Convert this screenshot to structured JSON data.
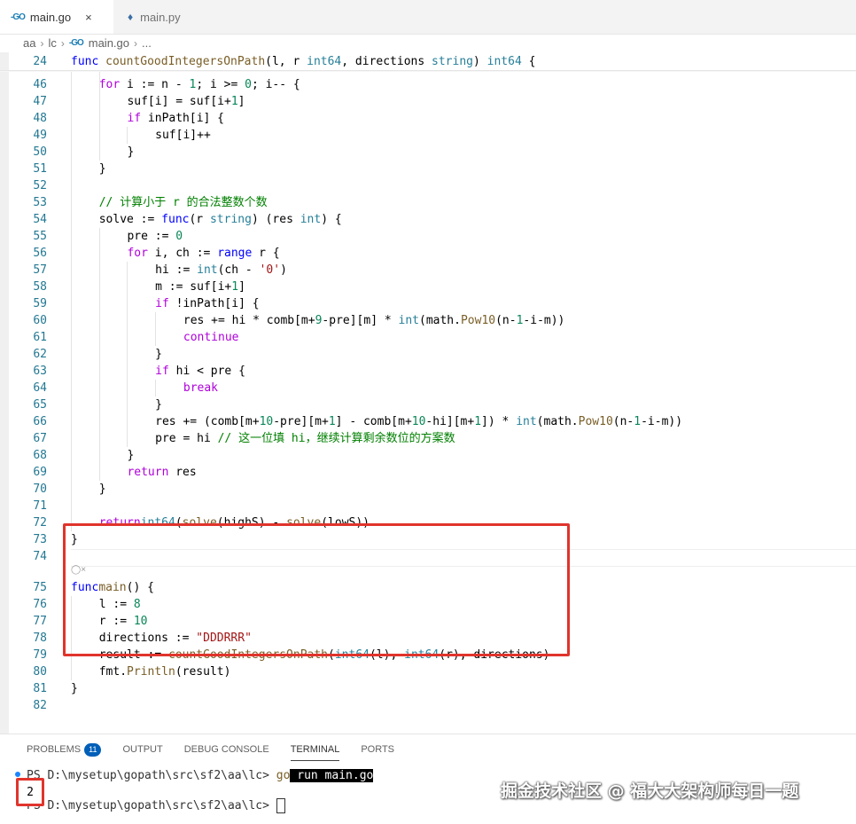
{
  "tabs": [
    {
      "label": "main.go",
      "icon": "go-file-icon",
      "active": true
    },
    {
      "label": "main.py",
      "icon": "python-file-icon",
      "active": false
    }
  ],
  "tab_icon_text": "-GO",
  "close_glyph": "×",
  "breadcrumb": [
    "aa",
    "lc",
    "main.go",
    "..."
  ],
  "sticky": {
    "ln": "24",
    "tokens": [
      [
        "kw",
        "func "
      ],
      [
        "fn",
        "countGoodIntegersOnPath"
      ],
      [
        "",
        "(l, r "
      ],
      [
        "ty",
        "int64"
      ],
      [
        "",
        ", directions "
      ],
      [
        "ty",
        "string"
      ],
      [
        "",
        ") "
      ],
      [
        "ty",
        "int64"
      ],
      [
        "",
        " {"
      ]
    ]
  },
  "code_lines": [
    {
      "ln": "46",
      "indent": 1,
      "tokens": [
        [
          "kwc",
          "for"
        ],
        [
          "",
          " i := n - "
        ],
        [
          "num",
          "1"
        ],
        [
          "",
          "; i >= "
        ],
        [
          "num",
          "0"
        ],
        [
          "",
          "; i-- {"
        ]
      ]
    },
    {
      "ln": "47",
      "indent": 2,
      "tokens": [
        [
          "",
          "suf[i] = suf[i+"
        ],
        [
          "num",
          "1"
        ],
        [
          "",
          "]"
        ]
      ]
    },
    {
      "ln": "48",
      "indent": 2,
      "tokens": [
        [
          "kwc",
          "if"
        ],
        [
          "",
          " inPath[i] {"
        ]
      ]
    },
    {
      "ln": "49",
      "indent": 3,
      "tokens": [
        [
          "",
          "suf[i]++"
        ]
      ]
    },
    {
      "ln": "50",
      "indent": 2,
      "tokens": [
        [
          "",
          "}"
        ]
      ]
    },
    {
      "ln": "51",
      "indent": 1,
      "tokens": [
        [
          "",
          "}"
        ]
      ]
    },
    {
      "ln": "52",
      "indent": 0,
      "tokens": []
    },
    {
      "ln": "53",
      "indent": 1,
      "tokens": [
        [
          "cmt",
          "// 计算小于 r 的合法整数个数"
        ]
      ]
    },
    {
      "ln": "54",
      "indent": 1,
      "tokens": [
        [
          "",
          "solve := "
        ],
        [
          "kw",
          "func"
        ],
        [
          "",
          "(r "
        ],
        [
          "ty",
          "string"
        ],
        [
          "",
          ") (res "
        ],
        [
          "ty",
          "int"
        ],
        [
          "",
          ") {"
        ]
      ]
    },
    {
      "ln": "55",
      "indent": 2,
      "tokens": [
        [
          "",
          "pre := "
        ],
        [
          "num",
          "0"
        ]
      ]
    },
    {
      "ln": "56",
      "indent": 2,
      "tokens": [
        [
          "kwc",
          "for"
        ],
        [
          "",
          " i, ch := "
        ],
        [
          "kw",
          "range"
        ],
        [
          "",
          " r {"
        ]
      ]
    },
    {
      "ln": "57",
      "indent": 3,
      "tokens": [
        [
          "",
          "hi := "
        ],
        [
          "ty",
          "int"
        ],
        [
          "",
          "(ch - "
        ],
        [
          "str",
          "'0'"
        ],
        [
          "",
          ")"
        ]
      ]
    },
    {
      "ln": "58",
      "indent": 3,
      "tokens": [
        [
          "",
          "m := suf[i+"
        ],
        [
          "num",
          "1"
        ],
        [
          "",
          "]"
        ]
      ]
    },
    {
      "ln": "59",
      "indent": 3,
      "tokens": [
        [
          "kwc",
          "if"
        ],
        [
          "",
          " !inPath[i] {"
        ]
      ]
    },
    {
      "ln": "60",
      "indent": 4,
      "tokens": [
        [
          "",
          "res += hi * comb[m+"
        ],
        [
          "num",
          "9"
        ],
        [
          "",
          "-pre][m] * "
        ],
        [
          "ty",
          "int"
        ],
        [
          "",
          "(math."
        ],
        [
          "fn",
          "Pow10"
        ],
        [
          "",
          "(n-"
        ],
        [
          "num",
          "1"
        ],
        [
          "",
          "-i-m))"
        ]
      ]
    },
    {
      "ln": "61",
      "indent": 4,
      "tokens": [
        [
          "kwc",
          "continue"
        ]
      ]
    },
    {
      "ln": "62",
      "indent": 3,
      "tokens": [
        [
          "",
          "}"
        ]
      ]
    },
    {
      "ln": "63",
      "indent": 3,
      "tokens": [
        [
          "kwc",
          "if"
        ],
        [
          "",
          " hi < pre {"
        ]
      ]
    },
    {
      "ln": "64",
      "indent": 4,
      "tokens": [
        [
          "kwc",
          "break"
        ]
      ]
    },
    {
      "ln": "65",
      "indent": 3,
      "tokens": [
        [
          "",
          "}"
        ]
      ]
    },
    {
      "ln": "66",
      "indent": 3,
      "tokens": [
        [
          "",
          "res += (comb[m+"
        ],
        [
          "num",
          "10"
        ],
        [
          "",
          "-pre][m+"
        ],
        [
          "num",
          "1"
        ],
        [
          "",
          "] - comb[m+"
        ],
        [
          "num",
          "10"
        ],
        [
          "",
          "-hi][m+"
        ],
        [
          "num",
          "1"
        ],
        [
          "",
          "]) * "
        ],
        [
          "ty",
          "int"
        ],
        [
          "",
          "(math."
        ],
        [
          "fn",
          "Pow10"
        ],
        [
          "",
          "(n-"
        ],
        [
          "num",
          "1"
        ],
        [
          "",
          "-i-m))"
        ]
      ]
    },
    {
      "ln": "67",
      "indent": 3,
      "tokens": [
        [
          "",
          "pre = hi "
        ],
        [
          "cmt",
          "// 这一位填 hi，继续计算剩余数位的方案数"
        ]
      ]
    },
    {
      "ln": "68",
      "indent": 2,
      "tokens": [
        [
          "",
          "}"
        ]
      ]
    },
    {
      "ln": "69",
      "indent": 2,
      "tokens": [
        [
          "kwc",
          "return"
        ],
        [
          "",
          " res"
        ]
      ]
    },
    {
      "ln": "70",
      "indent": 1,
      "tokens": [
        [
          "",
          "}"
        ]
      ]
    },
    {
      "ln": "71",
      "indent": 0,
      "tokens": []
    },
    {
      "ln": "72",
      "indent": 1,
      "tokens": [
        [
          "kwc",
          "return"
        ],
        [
          " ",
          ""
        ],
        [
          "ty",
          "int64"
        ],
        [
          "",
          "("
        ],
        [
          "fn",
          "solve"
        ],
        [
          "",
          "(highS) - "
        ],
        [
          "fn",
          "solve"
        ],
        [
          "",
          "(lowS))"
        ]
      ]
    },
    {
      "ln": "73",
      "indent": 0,
      "tokens": [
        [
          "",
          "}"
        ]
      ]
    },
    {
      "ln": "74",
      "indent": 0,
      "tokens": []
    },
    {
      "ln": "75",
      "indent": 0,
      "tokens": [
        [
          "kw",
          "func"
        ],
        [
          " ",
          ""
        ],
        [
          "fn",
          "main"
        ],
        [
          "",
          "() {"
        ]
      ]
    },
    {
      "ln": "76",
      "indent": 1,
      "tokens": [
        [
          "",
          "l := "
        ],
        [
          "num",
          "8"
        ]
      ]
    },
    {
      "ln": "77",
      "indent": 1,
      "tokens": [
        [
          "",
          "r := "
        ],
        [
          "num",
          "10"
        ]
      ]
    },
    {
      "ln": "78",
      "indent": 1,
      "tokens": [
        [
          "",
          "directions := "
        ],
        [
          "str",
          "\"DDDRRR\""
        ]
      ]
    },
    {
      "ln": "79",
      "indent": 1,
      "tokens": [
        [
          "",
          "result := "
        ],
        [
          "fn",
          "countGoodIntegersOnPath"
        ],
        [
          "",
          "("
        ],
        [
          "ty",
          "int64"
        ],
        [
          "",
          "(l), "
        ],
        [
          "ty",
          "int64"
        ],
        [
          "",
          "(r), directions)"
        ]
      ]
    },
    {
      "ln": "80",
      "indent": 1,
      "tokens": [
        [
          "",
          "fmt."
        ],
        [
          "fn",
          "Println"
        ],
        [
          "",
          "(result)"
        ]
      ]
    },
    {
      "ln": "81",
      "indent": 0,
      "tokens": [
        [
          "",
          "}"
        ]
      ]
    },
    {
      "ln": "82",
      "indent": 0,
      "tokens": []
    }
  ],
  "panel": {
    "tabs": [
      {
        "label": "PROBLEMS",
        "badge": "11"
      },
      {
        "label": "OUTPUT"
      },
      {
        "label": "DEBUG CONSOLE"
      },
      {
        "label": "TERMINAL",
        "active": true
      },
      {
        "label": "PORTS"
      }
    ]
  },
  "terminal": {
    "prompt1": "PS D:\\mysetup\\gopath\\src\\sf2\\aa\\lc> ",
    "cmd_go": "go",
    "cmd_rest": " run main.go",
    "output": "2",
    "prompt2": "PS D:\\mysetup\\gopath\\src\\sf2\\aa\\lc> "
  },
  "watermark": "掘金技术社区 @ 福大大架构师每日一题",
  "colors": {
    "accent_red": "#e0342c",
    "badge_blue": "#005fb8",
    "line_number": "#237893"
  }
}
